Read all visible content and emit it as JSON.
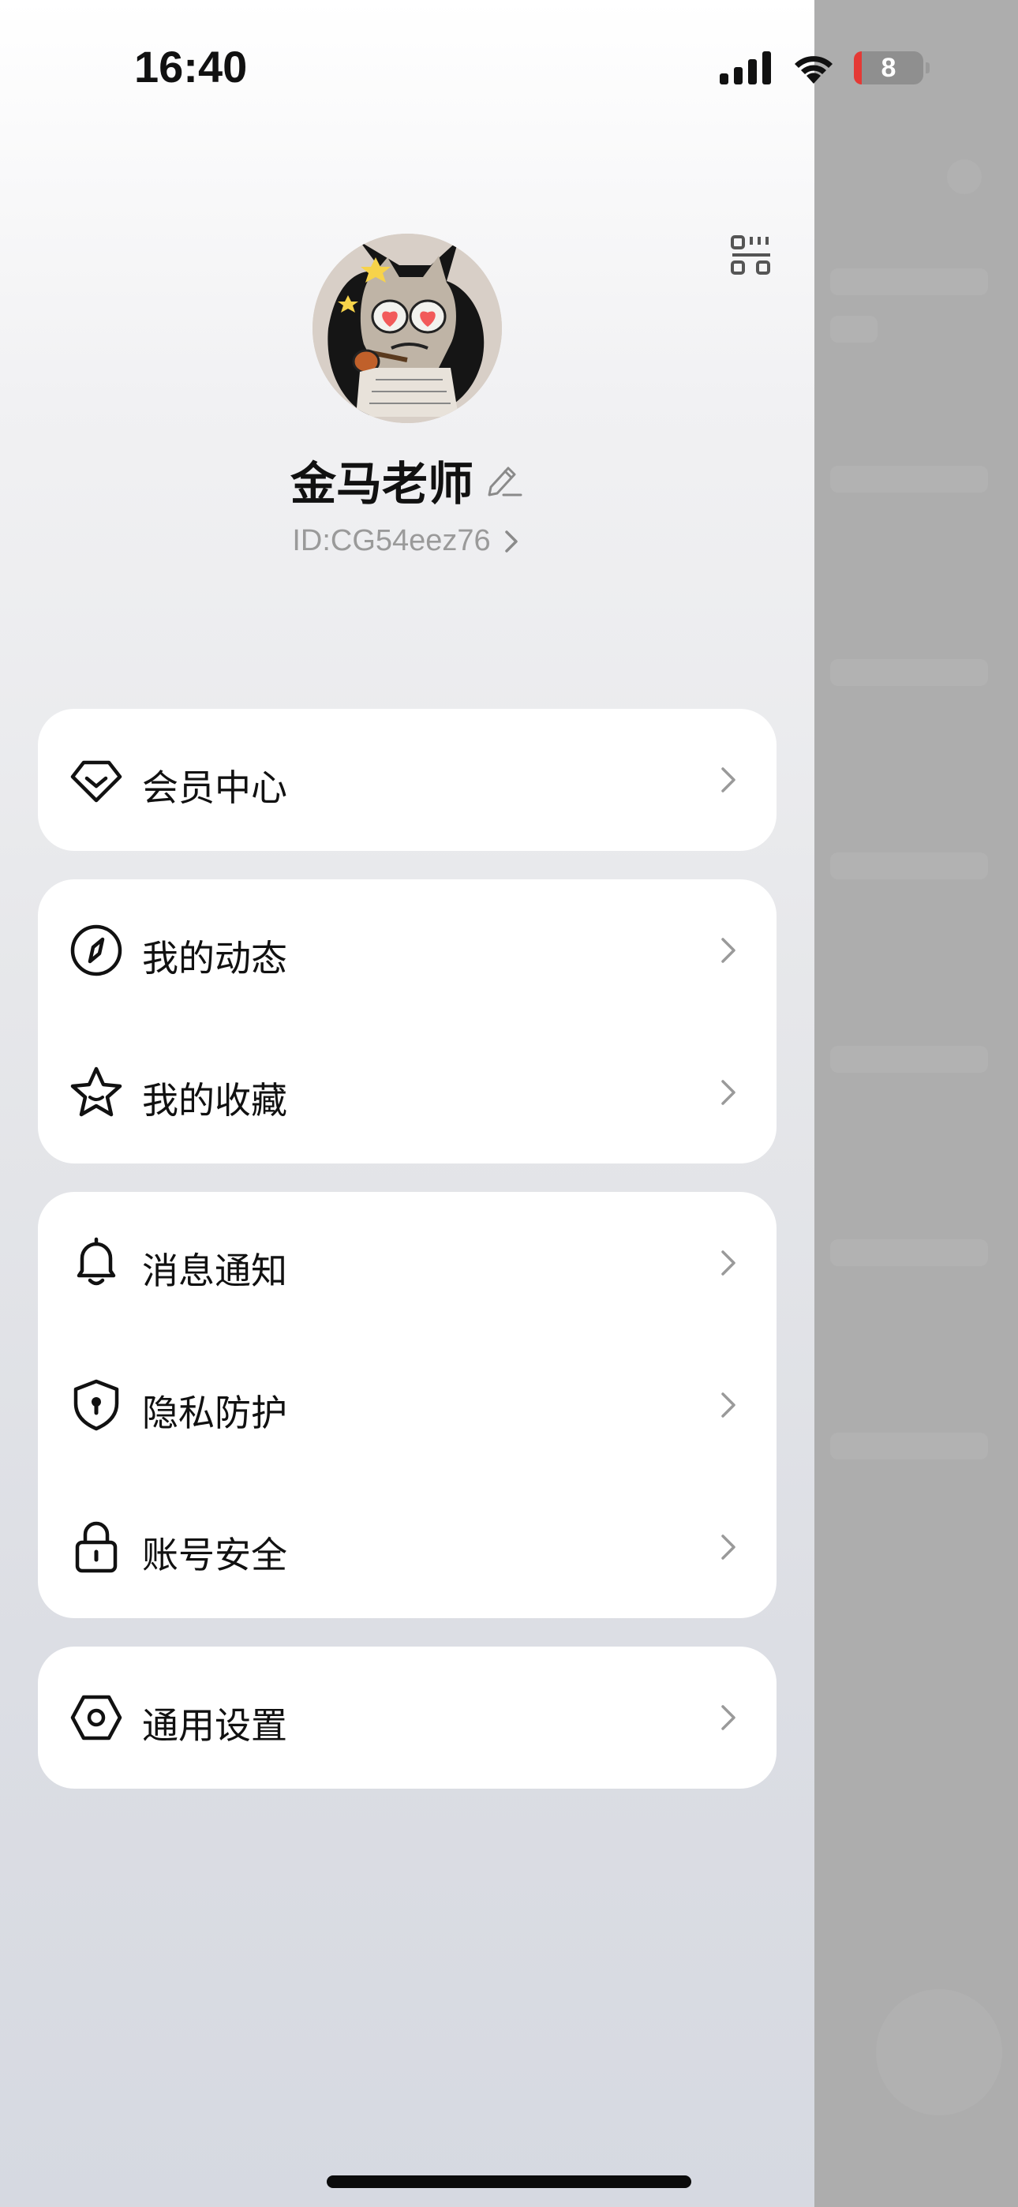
{
  "status_bar": {
    "time": "16:40",
    "battery_level": "8",
    "icons": [
      "cellular-signal-icon",
      "wifi-icon",
      "battery-icon"
    ]
  },
  "profile": {
    "name": "金马老师",
    "id": "ID:CG54eez76"
  },
  "menu": {
    "groups": [
      {
        "items": [
          {
            "label": "会员中心",
            "icon": "vip-diamond-icon"
          }
        ]
      },
      {
        "items": [
          {
            "label": "我的动态",
            "icon": "compass-icon"
          },
          {
            "label": "我的收藏",
            "icon": "star-icon"
          }
        ]
      },
      {
        "items": [
          {
            "label": "消息通知",
            "icon": "bell-icon"
          },
          {
            "label": "隐私防护",
            "icon": "shield-icon"
          },
          {
            "label": "账号安全",
            "icon": "lock-icon"
          }
        ]
      },
      {
        "items": [
          {
            "label": "通用设置",
            "icon": "settings-hexagon-icon"
          }
        ]
      }
    ]
  },
  "colors": {
    "card_background": "#ffffff",
    "text_primary": "#111111",
    "text_secondary": "#9a9a9a",
    "battery_low": "#e53935",
    "backdrop": "#adadad"
  }
}
